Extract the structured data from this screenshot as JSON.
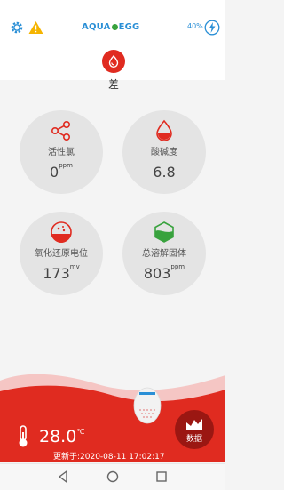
{
  "header": {
    "logo_text": "AQUA",
    "logo_text2": "EGG",
    "battery_text": "40%"
  },
  "status": {
    "label": "差"
  },
  "cards": [
    {
      "name": "活性氯",
      "value": "0",
      "unit": "ppm"
    },
    {
      "name": "酸碱度",
      "value": "6.8",
      "unit": ""
    },
    {
      "name": "氧化还原电位",
      "value": "173",
      "unit": "mv"
    },
    {
      "name": "总溶解固体",
      "value": "803",
      "unit": "ppm"
    }
  ],
  "bottom": {
    "temperature": "28.0",
    "temp_unit": "℃",
    "updated_text": "更新于:2020-08-11 17:02:17",
    "data_button_label": "数据"
  },
  "colors": {
    "accent": "#e02b20",
    "brand": "#2a8fd6"
  }
}
